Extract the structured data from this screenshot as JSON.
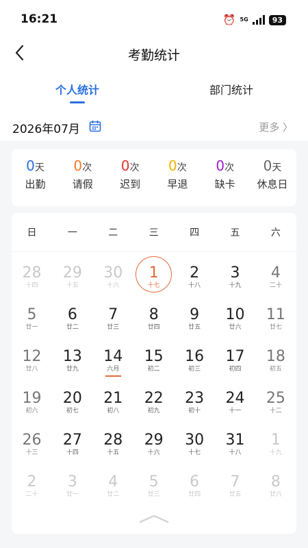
{
  "status": {
    "time": "16:21",
    "network": "5G",
    "battery": "93"
  },
  "nav": {
    "title": "考勤统计"
  },
  "tabs": [
    {
      "label": "个人统计",
      "active": true
    },
    {
      "label": "部门统计",
      "active": false
    }
  ],
  "month": {
    "label": "2026年07月",
    "more": "更多 〉"
  },
  "stats": [
    {
      "num": "0",
      "unit": "天",
      "label": "出勤",
      "color": "#2b6fe0"
    },
    {
      "num": "0",
      "unit": "次",
      "label": "请假",
      "color": "#f07a2c"
    },
    {
      "num": "0",
      "unit": "次",
      "label": "迟到",
      "color": "#e3342f"
    },
    {
      "num": "0",
      "unit": "次",
      "label": "早退",
      "color": "#f3b400"
    },
    {
      "num": "0",
      "unit": "次",
      "label": "缺卡",
      "color": "#a020c8"
    },
    {
      "num": "0",
      "unit": "天",
      "label": "休息日",
      "color": "#666666"
    }
  ],
  "weekdays": [
    "日",
    "一",
    "二",
    "三",
    "四",
    "五",
    "六"
  ],
  "days": [
    {
      "d": "28",
      "l": "十四",
      "other": true
    },
    {
      "d": "29",
      "l": "十五",
      "other": true
    },
    {
      "d": "30",
      "l": "十六",
      "other": true
    },
    {
      "d": "1",
      "l": "十七",
      "today": true
    },
    {
      "d": "2",
      "l": "十八"
    },
    {
      "d": "3",
      "l": "十九"
    },
    {
      "d": "4",
      "l": "二十"
    },
    {
      "d": "5",
      "l": "廿一"
    },
    {
      "d": "6",
      "l": "廿二"
    },
    {
      "d": "7",
      "l": "廿三"
    },
    {
      "d": "8",
      "l": "廿四"
    },
    {
      "d": "9",
      "l": "廿五"
    },
    {
      "d": "10",
      "l": "廿六"
    },
    {
      "d": "11",
      "l": "廿七"
    },
    {
      "d": "12",
      "l": "廿八"
    },
    {
      "d": "13",
      "l": "廿九"
    },
    {
      "d": "14",
      "l": "六月",
      "marked": true
    },
    {
      "d": "15",
      "l": "初二"
    },
    {
      "d": "16",
      "l": "初三"
    },
    {
      "d": "17",
      "l": "初四"
    },
    {
      "d": "18",
      "l": "初五"
    },
    {
      "d": "19",
      "l": "初六"
    },
    {
      "d": "20",
      "l": "初七"
    },
    {
      "d": "21",
      "l": "初八"
    },
    {
      "d": "22",
      "l": "初九"
    },
    {
      "d": "23",
      "l": "初十"
    },
    {
      "d": "24",
      "l": "十一"
    },
    {
      "d": "25",
      "l": "十二"
    },
    {
      "d": "26",
      "l": "十三"
    },
    {
      "d": "27",
      "l": "十四"
    },
    {
      "d": "28",
      "l": "十五"
    },
    {
      "d": "29",
      "l": "十六"
    },
    {
      "d": "30",
      "l": "十七"
    },
    {
      "d": "31",
      "l": "十八"
    },
    {
      "d": "1",
      "l": "十九",
      "other": true
    },
    {
      "d": "2",
      "l": "二十",
      "other": true
    },
    {
      "d": "3",
      "l": "廿一",
      "other": true
    },
    {
      "d": "4",
      "l": "廿二",
      "other": true
    },
    {
      "d": "5",
      "l": "廿三",
      "other": true
    },
    {
      "d": "6",
      "l": "廿四",
      "other": true
    },
    {
      "d": "7",
      "l": "廿五",
      "other": true
    },
    {
      "d": "8",
      "l": "廿六",
      "other": true
    }
  ],
  "colors": {
    "accent": "#2b6fe0",
    "today": "#e3693a"
  }
}
